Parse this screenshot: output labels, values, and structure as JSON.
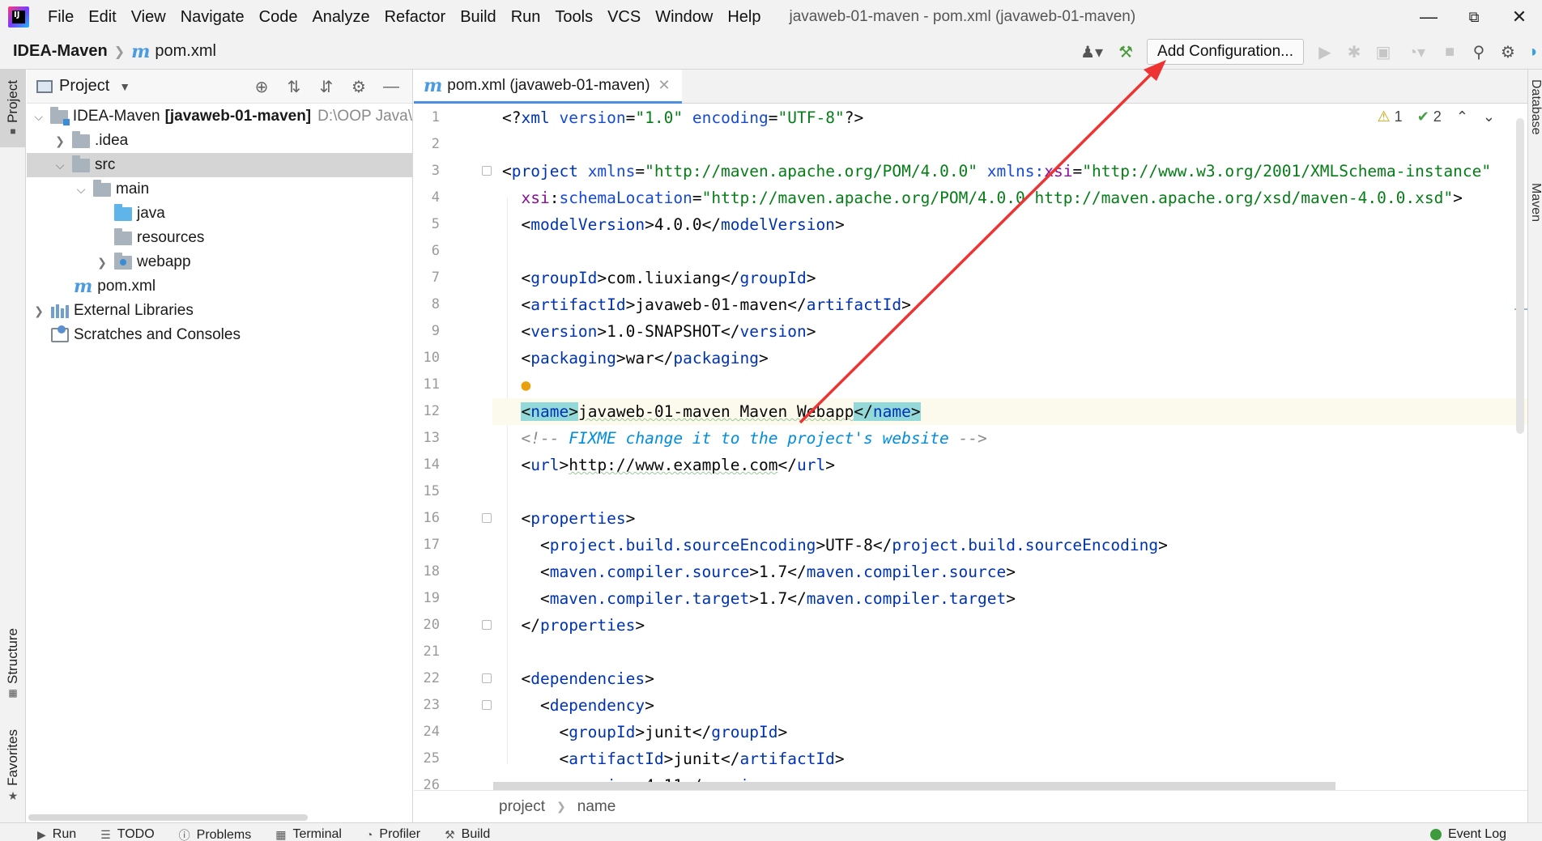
{
  "menu": {
    "items": [
      "File",
      "Edit",
      "View",
      "Navigate",
      "Code",
      "Analyze",
      "Refactor",
      "Build",
      "Run",
      "Tools",
      "VCS",
      "Window",
      "Help"
    ],
    "window_title": "javaweb-01-maven - pom.xml (javaweb-01-maven)"
  },
  "navbar": {
    "project": "IDEA-Maven",
    "file": "pom.xml",
    "add_configuration": "Add Configuration..."
  },
  "left_strip": {
    "project_tab": "Project",
    "structure_tab": "Structure",
    "favorites_tab": "Favorites"
  },
  "right_strip": {
    "database_tab": "Database",
    "maven_tab": "Maven"
  },
  "project_panel": {
    "title": "Project",
    "tree": [
      {
        "label": "IDEA-Maven",
        "suffix": "[javaweb-01-maven]",
        "path": "D:\\OOP Java\\",
        "depth": 0,
        "expanded": true,
        "icon": "module-folder-icon"
      },
      {
        "label": ".idea",
        "depth": 1,
        "expanded": false,
        "icon": "folder-icon"
      },
      {
        "label": "src",
        "depth": 1,
        "expanded": true,
        "icon": "folder-icon",
        "selected": true
      },
      {
        "label": "main",
        "depth": 2,
        "expanded": true,
        "icon": "folder-icon"
      },
      {
        "label": "java",
        "depth": 3,
        "icon": "source-folder-icon"
      },
      {
        "label": "resources",
        "depth": 3,
        "icon": "resources-folder-icon"
      },
      {
        "label": "webapp",
        "depth": 3,
        "expanded": false,
        "icon": "web-folder-icon"
      },
      {
        "label": "pom.xml",
        "depth": 2,
        "icon": "maven-file-icon"
      },
      {
        "label": "External Libraries",
        "depth": 0,
        "expanded": false,
        "icon": "library-icon"
      },
      {
        "label": "Scratches and Consoles",
        "depth": 0,
        "icon": "scratch-icon"
      }
    ]
  },
  "editor": {
    "tab_label": "pom.xml (javaweb-01-maven)",
    "inspections": {
      "warnings": "1",
      "ok": "2"
    },
    "line_numbers": [
      "1",
      "2",
      "3",
      "4",
      "5",
      "6",
      "7",
      "8",
      "9",
      "10",
      "11",
      "12",
      "13",
      "14",
      "15",
      "16",
      "17",
      "18",
      "19",
      "20",
      "21",
      "22",
      "23",
      "24",
      "25",
      "26"
    ],
    "breadcrumb": [
      "project",
      "name"
    ]
  },
  "bottom_bar": {
    "tools": [
      "Run",
      "TODO",
      "Problems",
      "Terminal",
      "Profiler",
      "Build"
    ],
    "event_log": "Event Log"
  },
  "colors": {
    "accent": "#4b8fe2",
    "annotation_arrow": "#ee3333",
    "xml_tag": "#0033b3",
    "xml_string": "#067d17"
  }
}
